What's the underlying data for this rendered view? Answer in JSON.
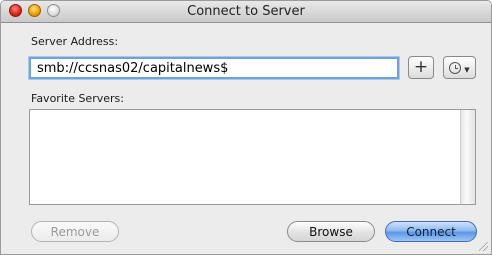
{
  "window": {
    "title": "Connect to Server"
  },
  "server_address": {
    "label": "Server Address:",
    "value": "smb://ccsnas02/capitalnews$",
    "add_icon": "plus-icon",
    "recent_icon": "clock-icon"
  },
  "favorites": {
    "label": "Favorite Servers:",
    "items": []
  },
  "buttons": {
    "remove": "Remove",
    "browse": "Browse",
    "connect": "Connect"
  },
  "colors": {
    "accent": "#5d97e3",
    "focus_ring": "#6ea2dc",
    "close": "#e0261c",
    "minimize": "#f0a300"
  }
}
